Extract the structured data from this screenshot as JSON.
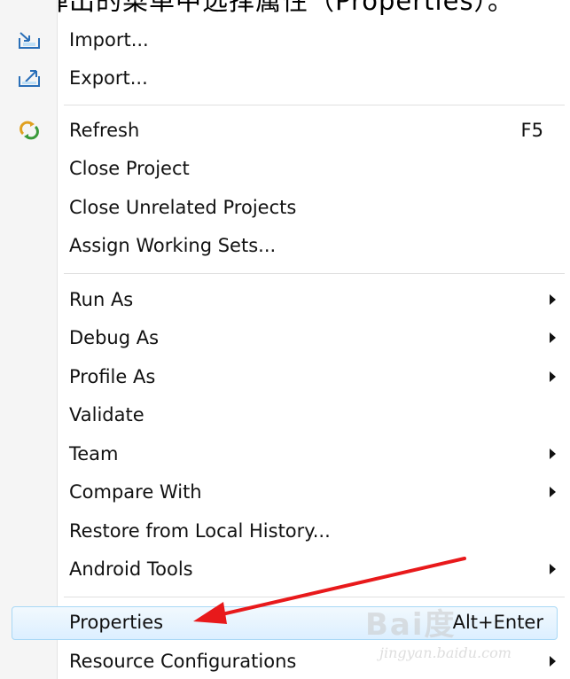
{
  "top_caption": "在弹出的菜单中选择属性（Properties）。",
  "menu": {
    "items": [
      {
        "label": "Import...",
        "icon": "import-icon"
      },
      {
        "label": "Export...",
        "icon": "export-icon"
      },
      {
        "label": "Refresh",
        "shortcut": "F5",
        "icon": "refresh-icon"
      },
      {
        "label": "Close Project"
      },
      {
        "label": "Close Unrelated Projects"
      },
      {
        "label": "Assign Working Sets..."
      },
      {
        "label": "Run As",
        "submenu": true
      },
      {
        "label": "Debug As",
        "submenu": true
      },
      {
        "label": "Profile As",
        "submenu": true
      },
      {
        "label": "Validate"
      },
      {
        "label": "Team",
        "submenu": true
      },
      {
        "label": "Compare With",
        "submenu": true
      },
      {
        "label": "Restore from Local History..."
      },
      {
        "label": "Android Tools",
        "submenu": true
      },
      {
        "label": "Properties",
        "shortcut": "Alt+Enter",
        "highlighted": true
      },
      {
        "label": "Resource Configurations",
        "submenu": true
      }
    ]
  },
  "watermark": {
    "brand": "Bai度",
    "sub": "jingyan.baidu.com"
  },
  "colors": {
    "highlight_border": "#a8d8f5",
    "arrow_red": "#e8191b"
  }
}
